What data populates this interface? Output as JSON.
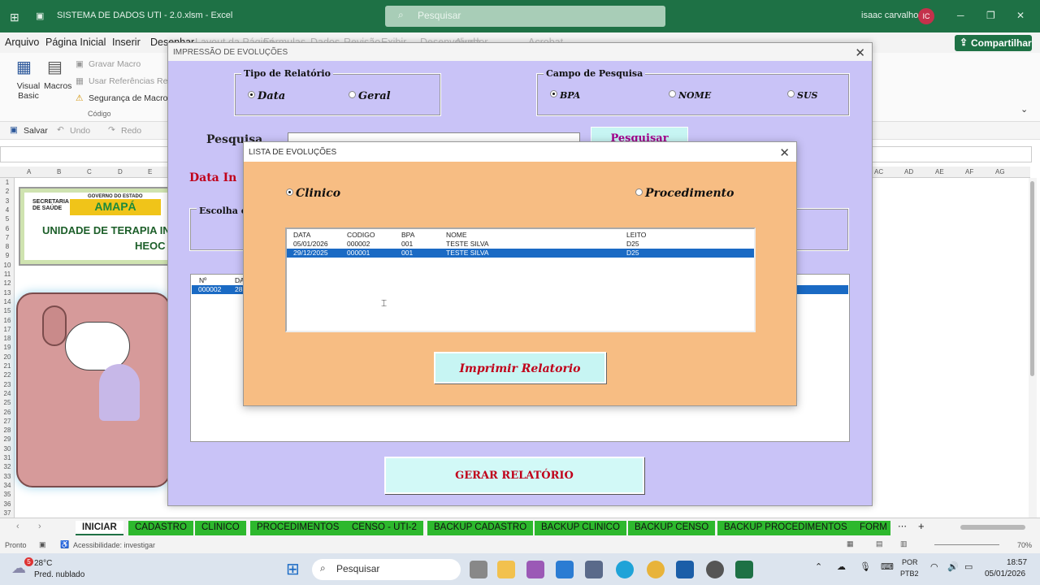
{
  "window": {
    "title": "SISTEMA DE DADOS UTI - 2.0.xlsm  -  Excel",
    "search_placeholder": "Pesquisar",
    "user": "isaac carvalho",
    "user_initials": "IC",
    "share_label": "Compartilhar"
  },
  "menu": [
    "Arquivo",
    "Página Inicial",
    "Inserir",
    "Desenhar",
    "Layout da Página",
    "Fórmulas",
    "Dados",
    "Revisão",
    "Exibir",
    "Desenvolvedor",
    "Ajuda",
    "Acrobat"
  ],
  "ribbon": {
    "visual_basic": "Visual Basic",
    "macros": "Macros",
    "gravar": "Gravar Macro",
    "referencias": "Usar Referências Relativas",
    "seguranca": "Segurança de Macro",
    "group": "Código"
  },
  "qat": {
    "salvar": "Salvar",
    "undo": "Undo",
    "redo": "Redo"
  },
  "columns": [
    "A",
    "B",
    "C",
    "D",
    "E",
    "AC",
    "AD",
    "AE",
    "AF",
    "AG"
  ],
  "rows": [
    "1",
    "2",
    "3",
    "4",
    "5",
    "6",
    "7",
    "8",
    "9",
    "10",
    "11",
    "12",
    "13",
    "14",
    "15",
    "16",
    "17",
    "18",
    "19",
    "20",
    "21",
    "22",
    "23",
    "24",
    "25",
    "26",
    "27",
    "28",
    "29",
    "30",
    "31",
    "32",
    "33",
    "34",
    "35",
    "36",
    "37"
  ],
  "sheet_logo": {
    "secretaria": "SECRETARIA DE SAÚDE",
    "governo": "GOVERNO DO ESTADO",
    "brand": "AMAPÁ",
    "unidade": "UNIDADE DE TERAPIA IN",
    "heoc": "HEOC"
  },
  "dialog_impressao": {
    "title": "IMPRESSÃO DE EVOLUÇÕES",
    "tipo_label": "Tipo de Relatório",
    "tipo_data": "Data",
    "tipo_geral": "Geral",
    "campo_label": "Campo de Pesquisa",
    "campo_bpa": "BPA",
    "campo_nome": "NOME",
    "campo_sus": "SUS",
    "pesquisa_label": "Pesquisa",
    "pesquisar_btn": "Pesquisar",
    "data_ini": "Data In",
    "escolha": "Escolha o",
    "list_header": [
      "Nº",
      "DA"
    ],
    "list_row": [
      "000002",
      "28"
    ],
    "gerar_btn": "GERAR RELATÓRIO"
  },
  "dialog_lista": {
    "title": "LISTA DE EVOLUÇÕES",
    "opt_clinico": "Clinico",
    "opt_procedimento": "Procedimento",
    "headers": [
      "DATA",
      "CODIGO",
      "BPA",
      "NOME",
      "LEITO"
    ],
    "rows": [
      [
        "05/01/2026",
        "000002",
        "001",
        "TESTE SILVA",
        "D25"
      ],
      [
        "29/12/2025",
        "000001",
        "001",
        "TESTE SILVA",
        "D25"
      ]
    ],
    "print_btn": "Imprimir Relatorio"
  },
  "tabs": [
    "INICIAR",
    "CADASTRO",
    "CLINICO",
    "PROCEDIMENTOS",
    "CENSO - UTI-2",
    "BACKUP CADASTRO",
    "BACKUP CLINICO",
    "BACKUP CENSO",
    "BACKUP PROCEDIMENTOS",
    "FORM"
  ],
  "status": {
    "ready": "Pronto",
    "access": "Acessibilidade: investigar",
    "zoom": "70%"
  },
  "taskbar": {
    "weather_temp": "28°C",
    "weather_desc": "Pred. nublado",
    "weather_badge": "5",
    "search": "Pesquisar",
    "lang1": "POR",
    "lang2": "PTB2",
    "time": "18:57",
    "date": "05/01/2026"
  }
}
